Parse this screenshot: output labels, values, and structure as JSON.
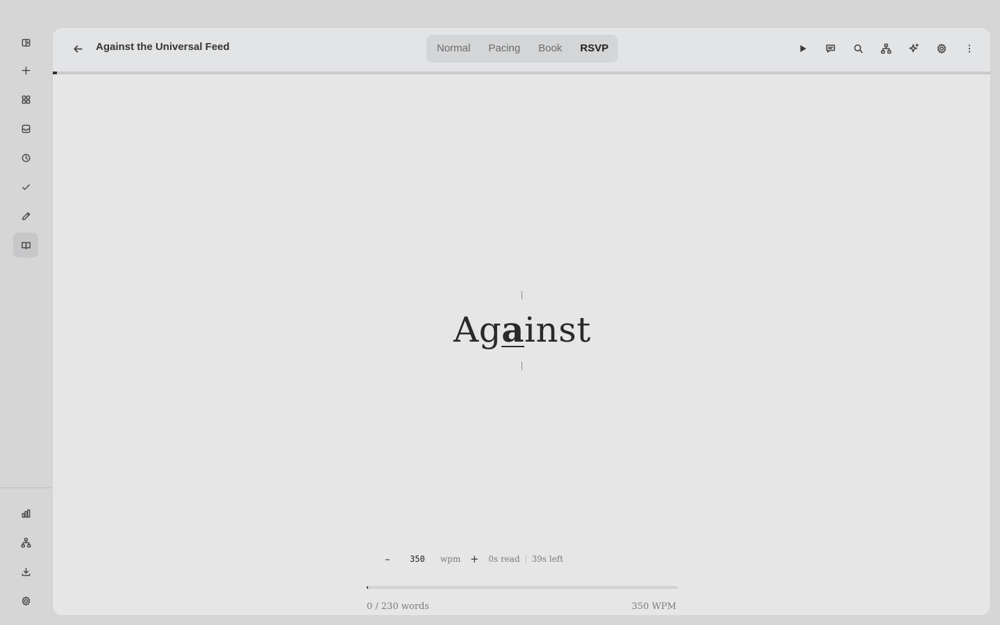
{
  "document": {
    "title": "Against the Universal Feed"
  },
  "modes": [
    {
      "label": "Normal",
      "active": false
    },
    {
      "label": "Pacing",
      "active": false
    },
    {
      "label": "Book",
      "active": false
    },
    {
      "label": "RSVP",
      "active": true
    }
  ],
  "rsvp": {
    "word_pre": "Ag",
    "word_focus": "a",
    "word_post": "inst",
    "wpm_value": "350",
    "wpm_unit": "wpm",
    "time_read": "0s read",
    "time_left": "39s left",
    "word_count": "0 / 230 words",
    "speed_label": "350 WPM",
    "reading_progress": 0.002,
    "page_progress": 0.003
  },
  "controls": {
    "decrease": "–",
    "increase": "+"
  },
  "sidebar": {
    "top_icons": [
      "sidebar-toggle-icon",
      "plus-icon",
      "grid-icon",
      "inbox-icon",
      "clock-icon",
      "check-icon",
      "pencil-icon",
      "book-icon"
    ],
    "bottom_icons": [
      "bar-chart-icon",
      "hierarchy-icon",
      "download-icon",
      "gear-icon"
    ],
    "active": "book-icon"
  },
  "toolbar_icons": [
    "play-icon",
    "comment-icon",
    "search-icon",
    "hierarchy-icon",
    "sparkle-icon",
    "gear-icon",
    "more-vertical-icon"
  ]
}
